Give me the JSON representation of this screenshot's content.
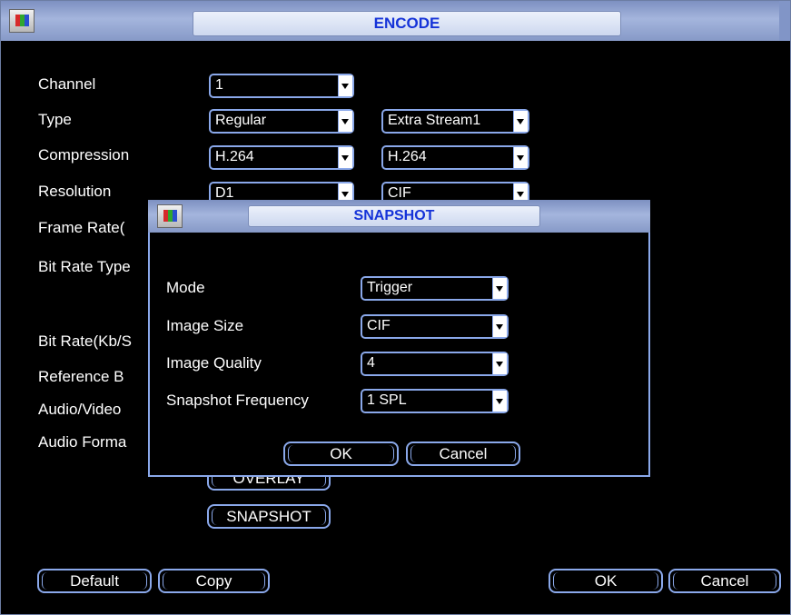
{
  "window": {
    "title": "ENCODE"
  },
  "labels": {
    "channel": "Channel",
    "type": "Type",
    "compression": "Compression",
    "resolution": "Resolution",
    "frame_rate": "Frame Rate(",
    "bit_rate_type": "Bit Rate Type",
    "bit_rate": "Bit Rate(Kb/S",
    "reference": "Reference B",
    "audio_video": "Audio/Video",
    "audio_format": "Audio Forma"
  },
  "fields": {
    "channel": "1",
    "type_main": "Regular",
    "type_extra": "Extra Stream1",
    "compression_main": "H.264",
    "compression_extra": "H.264",
    "resolution_main": "D1",
    "resolution_extra": "CIF"
  },
  "buttons": {
    "overlay": "OVERLAY",
    "snapshot": "SNAPSHOT",
    "default": "Default",
    "copy": "Copy",
    "ok": "OK",
    "cancel": "Cancel"
  },
  "dialog": {
    "title": "SNAPSHOT",
    "mode_label": "Mode",
    "mode_value": "Trigger",
    "image_size_label": "Image Size",
    "image_size_value": "CIF",
    "image_quality_label": "Image Quality",
    "image_quality_value": "4",
    "frequency_label": "Snapshot Frequency",
    "frequency_value": "1 SPL",
    "ok": "OK",
    "cancel": "Cancel"
  },
  "colors": {
    "accent": "#8aa8ea",
    "title_text": "#1533d8",
    "titlebar": "#a4b5dd"
  }
}
